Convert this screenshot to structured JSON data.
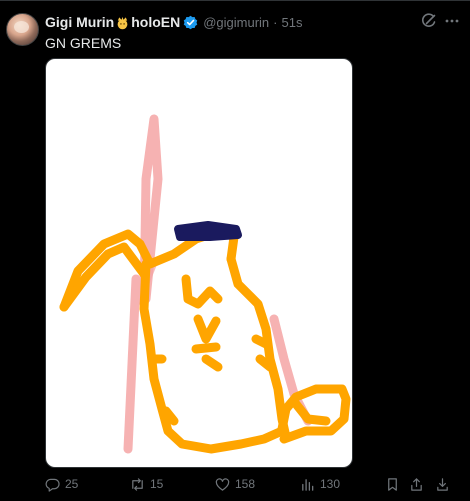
{
  "post": {
    "author_name": "Gigi Murin",
    "author_name_suffix": "holoEN",
    "handle": "@gigimurin",
    "separator": "·",
    "timestamp": "51s",
    "text": "GN GREMS"
  },
  "icons": {
    "avatar": "avatar",
    "name_emoji": "crown-face-emoji-icon",
    "verified": "verified-badge-icon",
    "grok": "grok-icon",
    "more": "more-icon",
    "reply": "reply-icon",
    "repost": "repost-icon",
    "like": "like-icon",
    "views": "views-icon",
    "bookmark": "bookmark-icon",
    "share": "share-icon",
    "download": "download-icon"
  },
  "actions": {
    "reply_count": "25",
    "repost_count": "15",
    "like_count": "158",
    "views_count": "130"
  },
  "colors": {
    "background": "#000000",
    "text_primary": "#e7e9ea",
    "text_secondary": "#71767b",
    "verified": "#1d9bf0",
    "drawing_orange": "#ffa500",
    "drawing_pink": "#f4a4a4",
    "drawing_navy": "#1a1a5e"
  }
}
